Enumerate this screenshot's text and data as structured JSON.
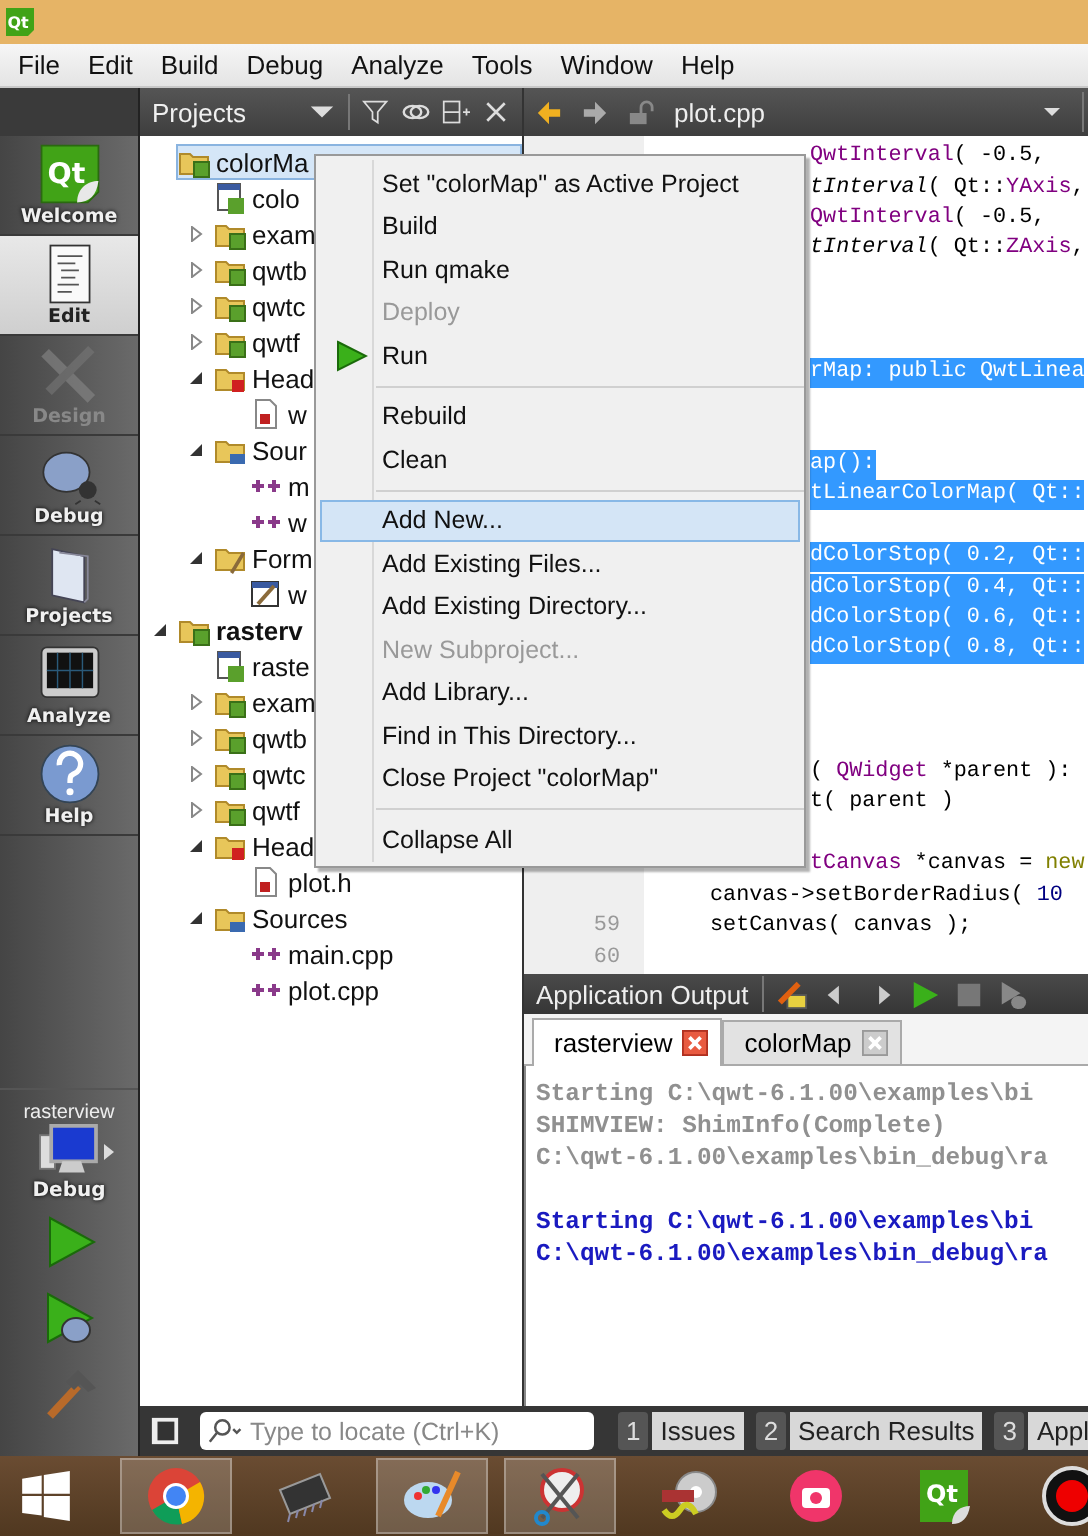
{
  "window": {
    "logo_text": "Qt"
  },
  "menu_bar": [
    "File",
    "Edit",
    "Build",
    "Debug",
    "Analyze",
    "Tools",
    "Window",
    "Help"
  ],
  "mode_bar": {
    "items": [
      {
        "label": "Welcome",
        "kind": "welcome",
        "logo_text": "Qt",
        "selected": false,
        "disabled": false
      },
      {
        "label": "Edit",
        "kind": "edit",
        "selected": true,
        "disabled": false
      },
      {
        "label": "Design",
        "kind": "design",
        "selected": false,
        "disabled": true
      },
      {
        "label": "Debug",
        "kind": "debug",
        "selected": false,
        "disabled": false
      },
      {
        "label": "Projects",
        "kind": "projects",
        "selected": false,
        "disabled": false
      },
      {
        "label": "Analyze",
        "kind": "analyze",
        "selected": false,
        "disabled": false
      },
      {
        "label": "Help",
        "kind": "help",
        "selected": false,
        "disabled": false
      }
    ],
    "kit": {
      "project": "rasterview",
      "build": "Debug"
    }
  },
  "projects_pane": {
    "title": "Projects",
    "tree": [
      {
        "label": "colorMa",
        "kind": "project",
        "expanded": true,
        "selected": true,
        "active": false,
        "children": [
          {
            "label": "colo",
            "kind": "pro",
            "selected": false
          },
          {
            "label": "exam",
            "kind": "subproject",
            "expanded": false,
            "selected": false
          },
          {
            "label": "qwtb",
            "kind": "subproject",
            "expanded": false,
            "selected": false
          },
          {
            "label": "qwtc",
            "kind": "subproject",
            "expanded": false,
            "selected": false
          },
          {
            "label": "qwtf",
            "kind": "subproject",
            "expanded": false,
            "selected": false
          },
          {
            "label": "Head",
            "kind": "headers",
            "expanded": true,
            "selected": false,
            "children": [
              {
                "label": "w",
                "kind": "header",
                "selected": false
              }
            ]
          },
          {
            "label": "Sour",
            "kind": "sources",
            "expanded": true,
            "selected": false,
            "children": [
              {
                "label": "m",
                "kind": "source",
                "selected": false
              },
              {
                "label": "w",
                "kind": "source",
                "selected": false
              }
            ]
          },
          {
            "label": "Form",
            "kind": "forms",
            "expanded": true,
            "selected": false,
            "children": [
              {
                "label": "w",
                "kind": "form",
                "selected": false
              }
            ]
          }
        ]
      },
      {
        "label": "rasterv",
        "kind": "project",
        "expanded": true,
        "selected": false,
        "active": true,
        "children": [
          {
            "label": "raste",
            "kind": "pro",
            "selected": false
          },
          {
            "label": "exam",
            "kind": "subproject",
            "expanded": false,
            "selected": false
          },
          {
            "label": "qwtb",
            "kind": "subproject",
            "expanded": false,
            "selected": false
          },
          {
            "label": "qwtc",
            "kind": "subproject",
            "expanded": false,
            "selected": false
          },
          {
            "label": "qwtf",
            "kind": "subproject",
            "expanded": false,
            "selected": false
          },
          {
            "label": "Head",
            "kind": "headers",
            "expanded": true,
            "selected": false,
            "children": [
              {
                "label": "plot.h",
                "kind": "header",
                "selected": false
              }
            ]
          },
          {
            "label": "Sources",
            "kind": "sources",
            "expanded": true,
            "selected": false,
            "children": [
              {
                "label": "main.cpp",
                "kind": "source",
                "selected": false
              },
              {
                "label": "plot.cpp",
                "kind": "source",
                "selected": false
              }
            ]
          }
        ]
      }
    ]
  },
  "context_menu": [
    {
      "kind": "item",
      "label": "Set \"colorMap\" as Active Project",
      "disabled": false,
      "selected": false
    },
    {
      "kind": "item",
      "label": "Build",
      "disabled": false,
      "selected": false
    },
    {
      "kind": "item",
      "label": "Run qmake",
      "disabled": false,
      "selected": false
    },
    {
      "kind": "item",
      "label": "Deploy",
      "disabled": true,
      "selected": false
    },
    {
      "kind": "run",
      "label": "Run",
      "disabled": false,
      "selected": false
    },
    {
      "kind": "separator"
    },
    {
      "kind": "item",
      "label": "Rebuild",
      "disabled": false,
      "selected": false
    },
    {
      "kind": "item",
      "label": "Clean",
      "disabled": false,
      "selected": false
    },
    {
      "kind": "separator"
    },
    {
      "kind": "item",
      "label": "Add New...",
      "disabled": false,
      "selected": true
    },
    {
      "kind": "item",
      "label": "Add Existing Files...",
      "disabled": false,
      "selected": false
    },
    {
      "kind": "item",
      "label": "Add Existing Directory...",
      "disabled": false,
      "selected": false
    },
    {
      "kind": "item",
      "label": "New Subproject...",
      "disabled": true,
      "selected": false
    },
    {
      "kind": "item",
      "label": "Add Library...",
      "disabled": false,
      "selected": false
    },
    {
      "kind": "item",
      "label": "Find in This Directory...",
      "disabled": false,
      "selected": false
    },
    {
      "kind": "item",
      "label": "Close Project \"colorMap\"",
      "disabled": false,
      "selected": false
    },
    {
      "kind": "separator"
    },
    {
      "kind": "item",
      "label": "Collapse All",
      "disabled": false,
      "selected": false
    }
  ],
  "editor": {
    "file": "plot.cpp",
    "rows": [
      {
        "kind": "code",
        "clipped": true,
        "selected": false,
        "segments": [
          {
            "text": "QwtInterval",
            "kind": "type"
          },
          {
            "text": "( -0.5,",
            "kind": "plain"
          }
        ]
      },
      {
        "kind": "code",
        "clipped": true,
        "selected": false,
        "segments": [
          {
            "text": "tInterval",
            "kind": "call"
          },
          {
            "text": "( Qt::",
            "kind": "plain"
          },
          {
            "text": "YAxis",
            "kind": "type"
          },
          {
            "text": ",",
            "kind": "plain"
          }
        ]
      },
      {
        "kind": "code",
        "clipped": true,
        "selected": false,
        "segments": [
          {
            "text": "QwtInterval",
            "kind": "type"
          },
          {
            "text": "( -0.5,",
            "kind": "plain"
          }
        ]
      },
      {
        "kind": "code",
        "clipped": true,
        "selected": false,
        "segments": [
          {
            "text": "tInterval",
            "kind": "call"
          },
          {
            "text": "( Qt::",
            "kind": "plain"
          },
          {
            "text": "ZAxis",
            "kind": "type"
          },
          {
            "text": ",",
            "kind": "plain"
          }
        ]
      },
      {
        "kind": "blank"
      },
      {
        "kind": "blank"
      },
      {
        "kind": "blank"
      },
      {
        "kind": "code",
        "clipped": true,
        "selected": true,
        "segments": [
          {
            "text": "rMap: public QwtLinea",
            "kind": "plain"
          }
        ]
      },
      {
        "kind": "blank"
      },
      {
        "kind": "blank"
      },
      {
        "kind": "code",
        "clipped": true,
        "selected": true,
        "segments": [
          {
            "text": "ap():",
            "kind": "plain"
          }
        ]
      },
      {
        "kind": "code",
        "clipped": true,
        "selected": true,
        "segments": [
          {
            "text": "tLinearColorMap( Qt::",
            "kind": "plain"
          }
        ]
      },
      {
        "kind": "blank"
      },
      {
        "kind": "code",
        "clipped": true,
        "selected": true,
        "segments": [
          {
            "text": "dColorStop( 0.2, Qt::",
            "kind": "plain"
          }
        ]
      },
      {
        "kind": "code",
        "clipped": true,
        "selected": true,
        "segments": [
          {
            "text": "dColorStop( 0.4, Qt::",
            "kind": "plain"
          }
        ]
      },
      {
        "kind": "code",
        "clipped": true,
        "selected": true,
        "segments": [
          {
            "text": "dColorStop( 0.6, Qt::",
            "kind": "plain"
          }
        ]
      },
      {
        "kind": "code",
        "clipped": true,
        "selected": true,
        "segments": [
          {
            "text": "dColorStop( 0.8, Qt::",
            "kind": "plain"
          }
        ]
      },
      {
        "kind": "blank"
      },
      {
        "kind": "blank"
      },
      {
        "kind": "blank"
      },
      {
        "kind": "code",
        "clipped": true,
        "selected": false,
        "segments": [
          {
            "text": "( ",
            "kind": "plain"
          },
          {
            "text": "QWidget",
            "kind": "type"
          },
          {
            "text": " *parent ):",
            "kind": "plain"
          }
        ]
      },
      {
        "kind": "code",
        "clipped": true,
        "selected": false,
        "segments": [
          {
            "text": "t( parent )",
            "kind": "plain"
          }
        ]
      },
      {
        "kind": "blank"
      },
      {
        "kind": "code",
        "clipped": true,
        "selected": false,
        "segments": [
          {
            "text": "tCanvas",
            "kind": "type"
          },
          {
            "text": " *canvas = ",
            "kind": "plain"
          },
          {
            "text": "new",
            "kind": "keyword"
          }
        ]
      },
      {
        "kind": "code",
        "selected": false,
        "segments": [
          {
            "text": "canvas->setBorderRadius( ",
            "kind": "plain"
          },
          {
            "text": "10",
            "kind": "number"
          }
        ]
      },
      {
        "kind": "code",
        "selected": false,
        "number": "59",
        "segments": [
          {
            "text": "setCanvas( canvas );",
            "kind": "plain"
          }
        ]
      },
      {
        "kind": "blank",
        "number": "60"
      }
    ]
  },
  "output": {
    "title": "Application Output",
    "tabs": [
      {
        "label": "rasterview",
        "selected": true
      },
      {
        "label": "colorMap",
        "selected": false
      }
    ],
    "lines": [
      {
        "kind": "old",
        "text": "Starting C:\\qwt-6.1.00\\examples\\bi"
      },
      {
        "kind": "old",
        "text": "SHIMVIEW: ShimInfo(Complete)"
      },
      {
        "kind": "old",
        "text": "C:\\qwt-6.1.00\\examples\\bin_debug\\ra"
      },
      {
        "kind": "blank"
      },
      {
        "kind": "new",
        "text": "Starting C:\\qwt-6.1.00\\examples\\bi"
      },
      {
        "kind": "new",
        "text": "C:\\qwt-6.1.00\\examples\\bin_debug\\ra"
      }
    ]
  },
  "status_bar": {
    "locator_placeholder": "Type to locate (Ctrl+K)",
    "panes": [
      {
        "number": "1",
        "label": "Issues"
      },
      {
        "number": "2",
        "label": "Search Results"
      },
      {
        "number": "3",
        "label": "Appl"
      }
    ]
  },
  "taskbar": {
    "apps": [
      {
        "kind": "chrome",
        "open": true
      },
      {
        "kind": "chip",
        "open": false
      },
      {
        "kind": "palette",
        "open": true
      },
      {
        "kind": "scissors",
        "open": true
      },
      {
        "kind": "disc",
        "open": false
      },
      {
        "kind": "camera",
        "open": false
      },
      {
        "kind": "qt",
        "open": false,
        "logo_text": "Qt"
      },
      {
        "kind": "record",
        "open": false
      }
    ]
  }
}
